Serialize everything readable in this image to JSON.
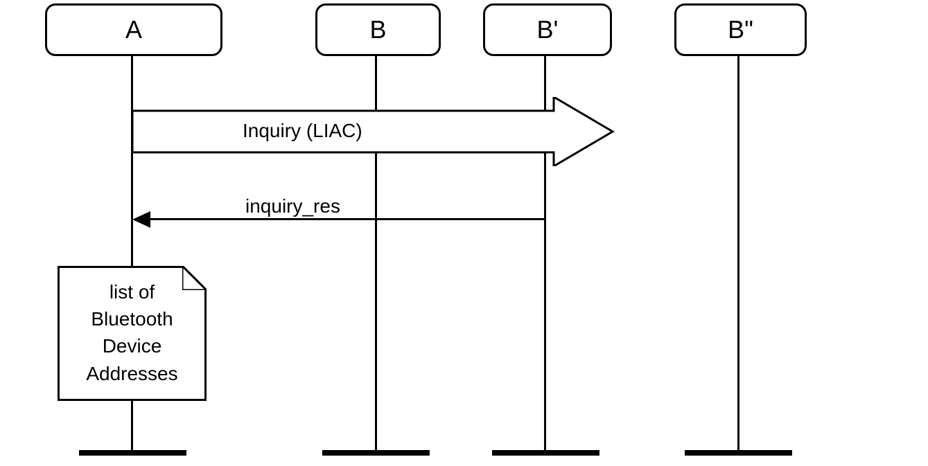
{
  "participants": {
    "a": "A",
    "b": "B",
    "b_prime": "B'",
    "b_double": "B\""
  },
  "messages": {
    "inquiry": "Inquiry (LIAC)",
    "response": "inquiry_res"
  },
  "note": {
    "line1": "list of",
    "line2": "Bluetooth",
    "line3": "Device",
    "line4": "Addresses"
  }
}
